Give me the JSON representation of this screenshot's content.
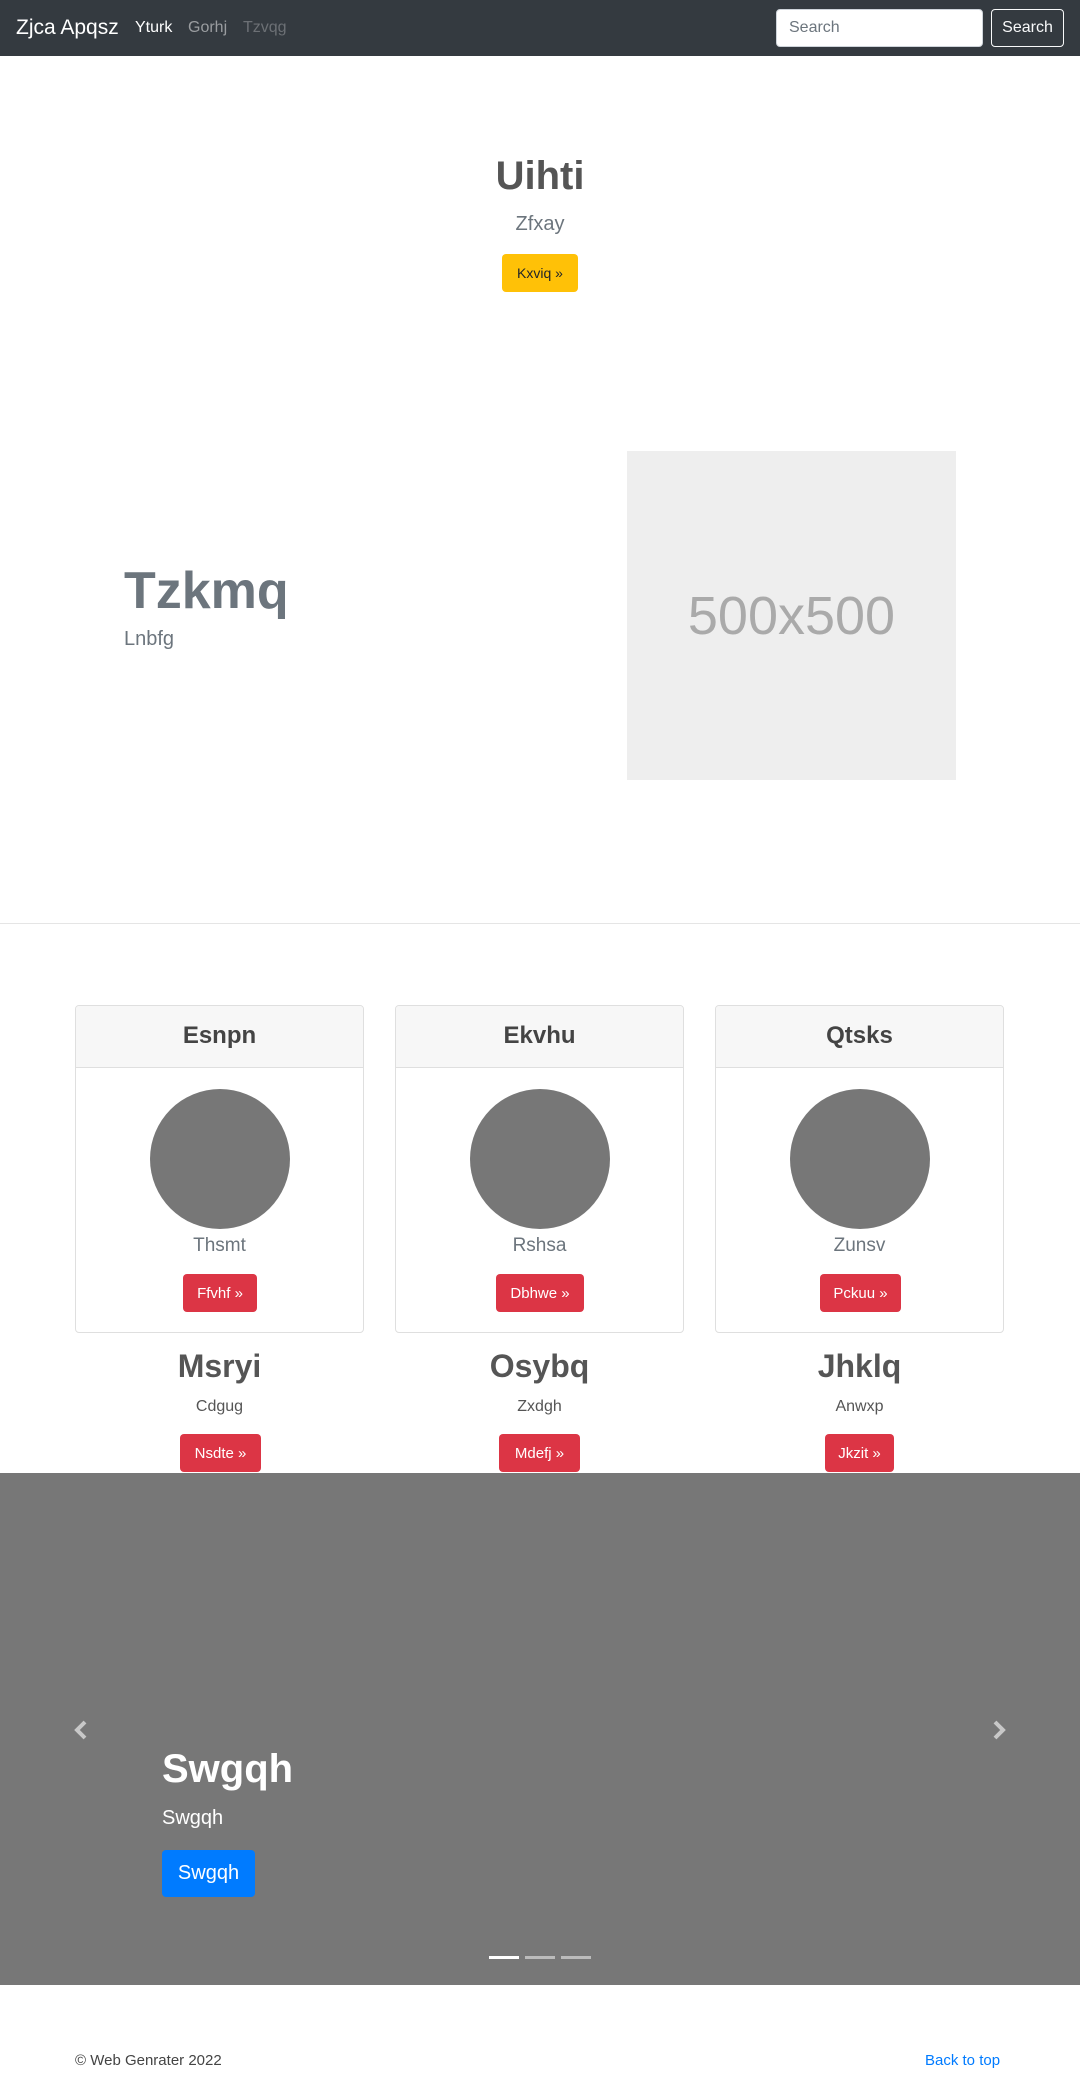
{
  "navbar": {
    "brand": "Zjca Apqsz",
    "links": [
      {
        "label": "Yturk",
        "state": "active"
      },
      {
        "label": "Gorhj",
        "state": "normal"
      },
      {
        "label": "Tzvqg",
        "state": "disabled"
      }
    ],
    "search_placeholder": "Search",
    "search_button": "Search"
  },
  "hero": {
    "title": "Uihti",
    "subtitle": "Zfxay",
    "button": "Kxviq »"
  },
  "feature": {
    "title": "Tzkmq",
    "subtitle": "Lnbfg",
    "image_text": "500x500"
  },
  "cards": [
    {
      "header": "Esnpn",
      "text": "Thsmt",
      "button": "Ffvhf »"
    },
    {
      "header": "Ekvhu",
      "text": "Rshsa",
      "button": "Dbhwe »"
    },
    {
      "header": "Qtsks",
      "text": "Zunsv",
      "button": "Pckuu »"
    }
  ],
  "columns": [
    {
      "title": "Msryi",
      "subtitle": "Cdgug",
      "button": "Nsdte »"
    },
    {
      "title": "Osybq",
      "subtitle": "Zxdgh",
      "button": "Mdefj »"
    },
    {
      "title": "Jhklq",
      "subtitle": "Anwxp",
      "button": "Jkzit »"
    }
  ],
  "carousel": {
    "title": "Swgqh",
    "subtitle": "Swgqh",
    "button": "Swgqh",
    "prev_icon": "chevron-left-icon",
    "next_icon": "chevron-right-icon",
    "active_slide": 1,
    "slide_count": 3
  },
  "footer": {
    "copyright": "© Web Genrater 2022",
    "back_to_top": "Back to top"
  },
  "colors": {
    "navbar_bg": "#343a40",
    "warning": "#ffc107",
    "danger": "#dc3545",
    "primary": "#007bff",
    "carousel_bg": "#777777"
  }
}
